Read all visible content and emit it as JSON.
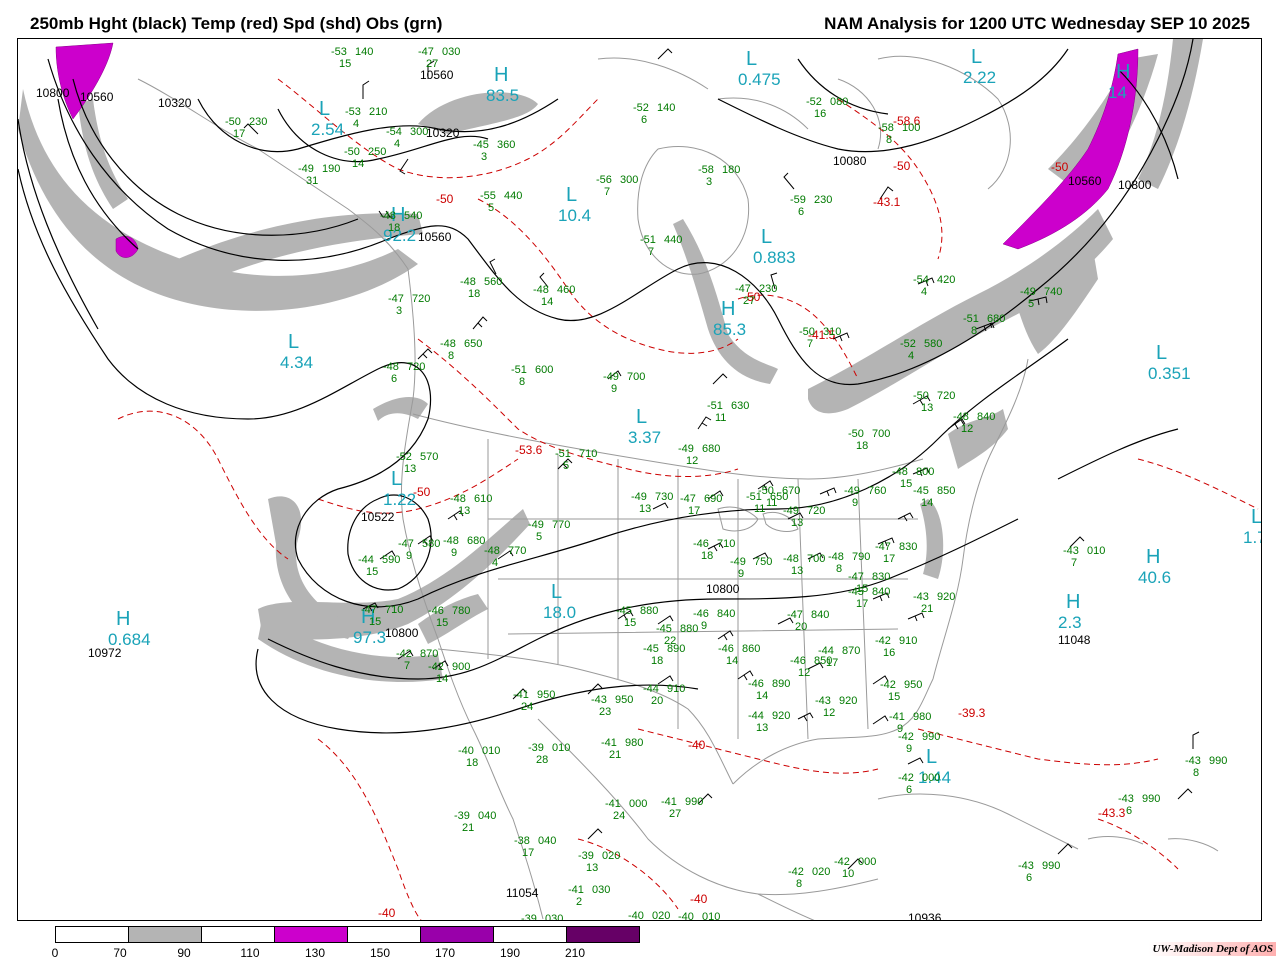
{
  "header": {
    "left_title": "250mb Hght (black) Temp (red) Spd (shd) Obs (grn)",
    "right_title": "NAM Analysis for 1200 UTC Wednesday  SEP 10 2025"
  },
  "colors": {
    "heights": "#000000",
    "temperature": "#cc0000",
    "observations": "#007a00",
    "highs_lows": "#1aa3b8",
    "speed_70_90": "#b4b4b4",
    "speed_110_130": "#cc00cc",
    "borders": "#9a9a9a"
  },
  "legend": {
    "ticks": [
      "0",
      "70",
      "90",
      "110",
      "130",
      "150",
      "170",
      "190",
      "210"
    ],
    "segments": [
      {
        "range": "0-70",
        "color": "#ffffff"
      },
      {
        "range": "70-90",
        "color": "#b4b4b4"
      },
      {
        "range": "90-110",
        "color": "#ffffff"
      },
      {
        "range": "110-130",
        "color": "#cc00cc"
      },
      {
        "range": "130-150",
        "color": "#ffffff"
      },
      {
        "range": "150-170",
        "color": "#9900aa"
      },
      {
        "range": "170-190",
        "color": "#ffffff"
      },
      {
        "range": "190-210",
        "color": "#660066"
      }
    ]
  },
  "credit": "UW-Madison  Dept of AOS",
  "centers": [
    {
      "letter": "L",
      "value": "2.54"
    },
    {
      "letter": "H",
      "value": "83.5"
    },
    {
      "letter": "L",
      "value": "0.475"
    },
    {
      "letter": "L",
      "value": "2.22"
    },
    {
      "letter": "H",
      "value": "14"
    },
    {
      "letter": "L",
      "value": "10.4"
    },
    {
      "letter": "H",
      "value": "92.2"
    },
    {
      "letter": "L",
      "value": "0.883"
    },
    {
      "letter": "H",
      "value": "85.3"
    },
    {
      "letter": "L",
      "value": "4.34"
    },
    {
      "letter": "L",
      "value": "0.351"
    },
    {
      "letter": "L",
      "value": "3.37"
    },
    {
      "letter": "L",
      "value": "1.22"
    },
    {
      "letter": "L",
      "value": "18.0"
    },
    {
      "letter": "H",
      "value": "97.3"
    },
    {
      "letter": "H",
      "value": "0.684"
    },
    {
      "letter": "H",
      "value": "40.6"
    },
    {
      "letter": "L",
      "value": "1.44"
    },
    {
      "letter": "H",
      "value": "2.3"
    },
    {
      "letter": "L",
      "value": "1.7"
    }
  ],
  "height_labels": [
    "10800",
    "10560",
    "10320",
    "10320",
    "10560",
    "10080",
    "10560",
    "10800",
    "10560",
    "10522",
    "10800",
    "10972",
    "10800",
    "11048",
    "10936",
    "11054"
  ],
  "temp_labels": [
    "-50",
    "-58.6",
    "-50",
    "-43.1",
    "-50",
    "-41.5",
    "-50",
    "-53.6",
    "-50",
    "-40",
    "-39.3",
    "-43.3",
    "-40",
    "-40"
  ],
  "observations": [
    {
      "t": "-53",
      "h": "140",
      "d": "15"
    },
    {
      "t": "-47",
      "h": "030",
      "d": "27"
    },
    {
      "t": "-50",
      "h": "230",
      "d": "17"
    },
    {
      "t": "-53",
      "h": "210",
      "d": "4"
    },
    {
      "t": "-54",
      "h": "300",
      "d": "4"
    },
    {
      "t": "-50",
      "h": "250",
      "d": "14"
    },
    {
      "t": "-49",
      "h": "190",
      "d": "31"
    },
    {
      "t": "-45",
      "h": "360",
      "d": "3"
    },
    {
      "t": "-52",
      "h": "140",
      "d": "6"
    },
    {
      "t": "-52",
      "h": "080",
      "d": "16"
    },
    {
      "t": "-58",
      "h": "100",
      "d": "8"
    },
    {
      "t": "-58",
      "h": "180",
      "d": "3"
    },
    {
      "t": "-56",
      "h": "300",
      "d": "7"
    },
    {
      "t": "-55",
      "h": "440",
      "d": "5"
    },
    {
      "t": "-59",
      "h": "230",
      "d": "6"
    },
    {
      "t": "-51",
      "h": "440",
      "d": "7"
    },
    {
      "t": "-48",
      "h": "540",
      "d": "18"
    },
    {
      "t": "-48",
      "h": "560",
      "d": "18"
    },
    {
      "t": "-48",
      "h": "460",
      "d": "14"
    },
    {
      "t": "-47",
      "h": "230",
      "d": "27"
    },
    {
      "t": "-54",
      "h": "420",
      "d": "4"
    },
    {
      "t": "-49",
      "h": "740",
      "d": "5"
    },
    {
      "t": "-51",
      "h": "680",
      "d": "8"
    },
    {
      "t": "-50",
      "h": "310",
      "d": "7"
    },
    {
      "t": "-52",
      "h": "580",
      "d": "4"
    },
    {
      "t": "-47",
      "h": "720",
      "d": "3"
    },
    {
      "t": "-48",
      "h": "650",
      "d": "8"
    },
    {
      "t": "-48",
      "h": "720",
      "d": "6"
    },
    {
      "t": "-51",
      "h": "600",
      "d": "8"
    },
    {
      "t": "-49",
      "h": "700",
      "d": "9"
    },
    {
      "t": "-51",
      "h": "630",
      "d": "11"
    },
    {
      "t": "-50",
      "h": "720",
      "d": "13"
    },
    {
      "t": "-48",
      "h": "840",
      "d": "12"
    },
    {
      "t": "-50",
      "h": "700",
      "d": "18"
    },
    {
      "t": "-52",
      "h": "570",
      "d": "13"
    },
    {
      "t": "-51",
      "h": "710",
      "d": "5"
    },
    {
      "t": "-49",
      "h": "680",
      "d": "12"
    },
    {
      "t": "-48",
      "h": "800",
      "d": "15"
    },
    {
      "t": "-48",
      "h": "610",
      "d": "13"
    },
    {
      "t": "-49",
      "h": "730",
      "d": "13"
    },
    {
      "t": "-47",
      "h": "690",
      "d": "17"
    },
    {
      "t": "-51",
      "h": "650",
      "d": "11"
    },
    {
      "t": "-50",
      "h": "670",
      "d": "11"
    },
    {
      "t": "-49",
      "h": "760",
      "d": "9"
    },
    {
      "t": "-45",
      "h": "850",
      "d": "14"
    },
    {
      "t": "-49",
      "h": "720",
      "d": "13"
    },
    {
      "t": "-49",
      "h": "770",
      "d": "5"
    },
    {
      "t": "-47",
      "h": "580",
      "d": "9"
    },
    {
      "t": "-48",
      "h": "680",
      "d": "9"
    },
    {
      "t": "-48",
      "h": "770",
      "d": "4"
    },
    {
      "t": "-44",
      "h": "590",
      "d": "15"
    },
    {
      "t": "-46",
      "h": "710",
      "d": "18"
    },
    {
      "t": "-49",
      "h": "750",
      "d": "9"
    },
    {
      "t": "-48",
      "h": "700",
      "d": "13"
    },
    {
      "t": "-48",
      "h": "790",
      "d": "8"
    },
    {
      "t": "-47",
      "h": "830",
      "d": "17"
    },
    {
      "t": "-47",
      "h": "830",
      "d": "15"
    },
    {
      "t": "-45",
      "h": "840",
      "d": "17"
    },
    {
      "t": "-43",
      "h": "920",
      "d": "21"
    },
    {
      "t": "-43",
      "h": "010",
      "d": "7"
    },
    {
      "t": "-47",
      "h": "710",
      "d": "15"
    },
    {
      "t": "-46",
      "h": "780",
      "d": "15"
    },
    {
      "t": "-45",
      "h": "880",
      "d": "15"
    },
    {
      "t": "-46",
      "h": "840",
      "d": "9"
    },
    {
      "t": "-47",
      "h": "840",
      "d": "20"
    },
    {
      "t": "-45",
      "h": "880",
      "d": "22"
    },
    {
      "t": "-42",
      "h": "870",
      "d": "7"
    },
    {
      "t": "-42",
      "h": "900",
      "d": "14"
    },
    {
      "t": "-45",
      "h": "890",
      "d": "18"
    },
    {
      "t": "-46",
      "h": "860",
      "d": "14"
    },
    {
      "t": "-46",
      "h": "850",
      "d": "12"
    },
    {
      "t": "-44",
      "h": "870",
      "d": "17"
    },
    {
      "t": "-42",
      "h": "910",
      "d": "16"
    },
    {
      "t": "-41",
      "h": "950",
      "d": "24"
    },
    {
      "t": "-43",
      "h": "950",
      "d": "23"
    },
    {
      "t": "-44",
      "h": "910",
      "d": "20"
    },
    {
      "t": "-46",
      "h": "890",
      "d": "14"
    },
    {
      "t": "-43",
      "h": "920",
      "d": "12"
    },
    {
      "t": "-44",
      "h": "920",
      "d": "13"
    },
    {
      "t": "-42",
      "h": "950",
      "d": "15"
    },
    {
      "t": "-41",
      "h": "980",
      "d": "9"
    },
    {
      "t": "-42",
      "h": "990",
      "d": "9"
    },
    {
      "t": "-40",
      "h": "010",
      "d": "18"
    },
    {
      "t": "-39",
      "h": "010",
      "d": "28"
    },
    {
      "t": "-41",
      "h": "980",
      "d": "21"
    },
    {
      "t": "-42",
      "h": "000",
      "d": "6"
    },
    {
      "t": "-43",
      "h": "990",
      "d": "6"
    },
    {
      "t": "-43",
      "h": "990",
      "d": "8"
    },
    {
      "t": "-39",
      "h": "040",
      "d": "21"
    },
    {
      "t": "-41",
      "h": "000",
      "d": "24"
    },
    {
      "t": "-41",
      "h": "990",
      "d": "27"
    },
    {
      "t": "-38",
      "h": "040",
      "d": "17"
    },
    {
      "t": "-39",
      "h": "020",
      "d": "13"
    },
    {
      "t": "-41",
      "h": "030",
      "d": "2"
    },
    {
      "t": "-42",
      "h": "020",
      "d": "8"
    },
    {
      "t": "-42",
      "h": "000",
      "d": "10"
    },
    {
      "t": "-43",
      "h": "990",
      "d": "6"
    },
    {
      "t": "-39",
      "h": "030",
      "d": ""
    },
    {
      "t": "-40",
      "h": "020",
      "d": ""
    },
    {
      "t": "-40",
      "h": "010",
      "d": ""
    }
  ]
}
